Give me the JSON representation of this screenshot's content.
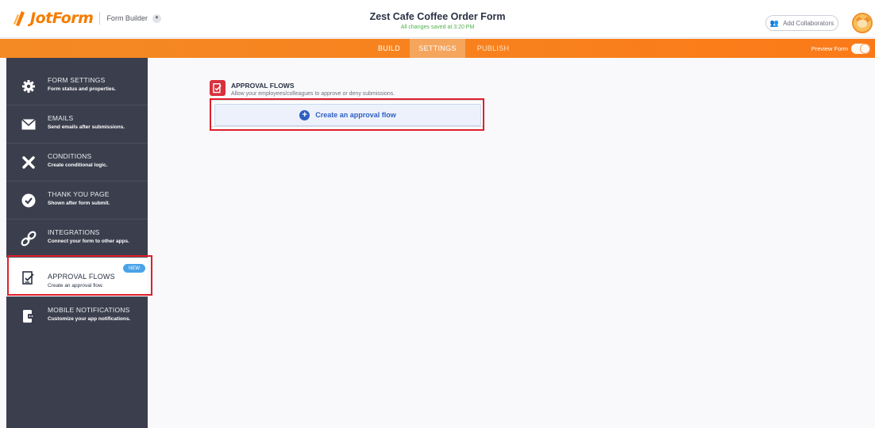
{
  "header": {
    "brand": "JotForm",
    "builder_label": "Form Builder",
    "form_title": "Zest Cafe Coffee Order Form",
    "save_status": "All changes saved at 3:20 PM",
    "collaborators_label": "Add Collaborators"
  },
  "nav": {
    "tabs": [
      {
        "label": "BUILD",
        "active": false
      },
      {
        "label": "SETTINGS",
        "active": true
      },
      {
        "label": "PUBLISH",
        "active": false
      }
    ],
    "preview_label": "Preview Form",
    "preview_on": true
  },
  "sidebar": {
    "items": [
      {
        "title": "FORM SETTINGS",
        "desc": "Form status and properties.",
        "icon": "gear-icon"
      },
      {
        "title": "EMAILS",
        "desc": "Send emails after submissions.",
        "icon": "envelope-icon"
      },
      {
        "title": "CONDITIONS",
        "desc": "Create conditional logic.",
        "icon": "wrench-icon"
      },
      {
        "title": "THANK YOU PAGE",
        "desc": "Shown after form submit.",
        "icon": "check-circle-icon"
      },
      {
        "title": "INTEGRATIONS",
        "desc": "Connect your form to other apps.",
        "icon": "link-icon"
      },
      {
        "title": "APPROVAL FLOWS",
        "desc": "Create an approval flow.",
        "icon": "approval-icon",
        "active": true,
        "badge": "NEW"
      },
      {
        "title": "MOBILE NOTIFICATIONS",
        "desc": "Customize your app notifications.",
        "icon": "mobile-notification-icon"
      }
    ]
  },
  "main": {
    "section_title": "APPROVAL FLOWS",
    "section_desc": "Allow your employees/colleagues to approve or deny submissions.",
    "create_label": "Create an approval flow"
  },
  "colors": {
    "brand_orange": "#f57c00",
    "sidebar_bg": "#3b3f4d",
    "accent_blue": "#2f5fc2",
    "highlight_red": "#e01e2b"
  }
}
